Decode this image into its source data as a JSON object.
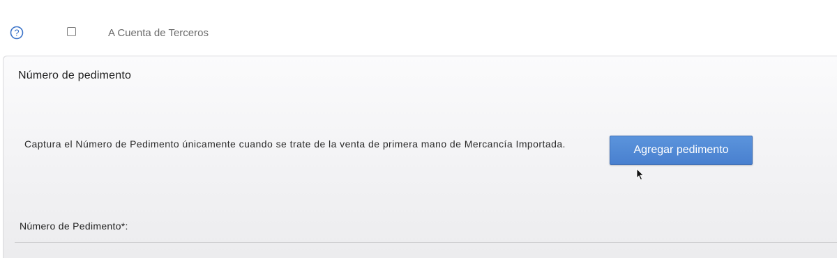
{
  "top_bar": {
    "help_icon": "question-circle-icon",
    "checkbox_label": "A Cuenta de Terceros",
    "checkbox_checked": false
  },
  "panel": {
    "title": "Número de pedimento",
    "description": "Captura el Número de Pedimento únicamente cuando se trate de la venta de primera mano de Mercancía Importada.",
    "add_button_label": "Agregar pedimento",
    "field_label": "Número de Pedimento*:"
  },
  "colors": {
    "accent_button": "#4f88d5",
    "help_icon": "#3b73c9"
  },
  "cursor_icon": "mouse-pointer-icon"
}
